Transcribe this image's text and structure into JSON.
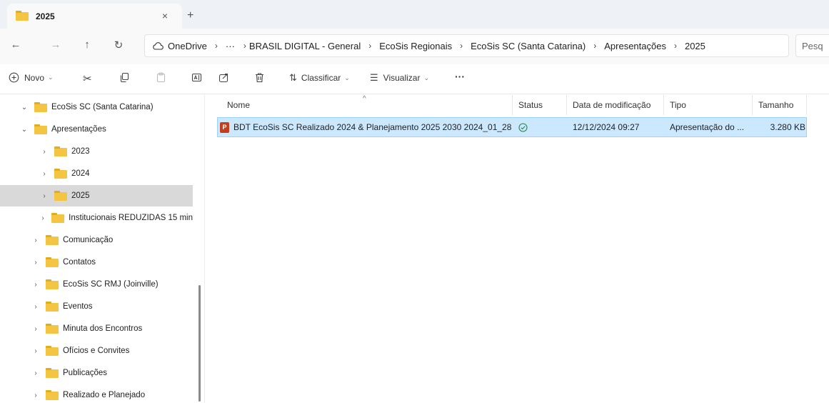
{
  "tab": {
    "title": "2025",
    "close": "×",
    "new": "+"
  },
  "nav": {
    "back": "←",
    "forward": "→",
    "up": "↑",
    "refresh": "↻"
  },
  "address": {
    "crumbs": [
      "OneDrive",
      "···",
      "BRASIL DIGITAL - General",
      "EcoSis Regionais",
      "EcoSis SC (Santa Catarina)",
      "Apresentações",
      "2025"
    ],
    "separator": "›"
  },
  "search": {
    "placeholder": "Pesq"
  },
  "toolbar": {
    "new_label": "Novo",
    "sort_label": "Classificar",
    "view_label": "Visualizar",
    "more_label": "···"
  },
  "sidebar": {
    "items": [
      {
        "label": "EcoSis SC (Santa Catarina)",
        "expanded": true
      },
      {
        "label": "Apresentações",
        "expanded": true
      },
      {
        "label": "2023",
        "expanded": false
      },
      {
        "label": "2024",
        "expanded": false
      },
      {
        "label": "2025",
        "expanded": false,
        "selected": true
      },
      {
        "label": "Institucionais REDUZIDAS 15 min",
        "expanded": false
      },
      {
        "label": "Comunicação",
        "expanded": false
      },
      {
        "label": "Contatos",
        "expanded": false
      },
      {
        "label": "EcoSis SC RMJ (Joinville)",
        "expanded": false
      },
      {
        "label": "Eventos",
        "expanded": false
      },
      {
        "label": "Minuta dos Encontros",
        "expanded": false
      },
      {
        "label": "Ofícios e Convites",
        "expanded": false
      },
      {
        "label": "Publicações",
        "expanded": false
      },
      {
        "label": "Realizado e Planejado",
        "expanded": false
      }
    ]
  },
  "columns": {
    "name": "Nome",
    "status": "Status",
    "modified": "Data de modificação",
    "type": "Tipo",
    "size": "Tamanho"
  },
  "files": [
    {
      "name": "BDT EcoSis SC Realizado 2024 & Planejamento 2025 2030 2024_01_28",
      "status_icon": "✓",
      "modified": "12/12/2024 09:27",
      "type": "Apresentação do ...",
      "size": "3.280 KB"
    }
  ],
  "colors": {
    "selected_row": "#cce8ff",
    "folder": "#f4c542",
    "ppt": "#c43e1c"
  }
}
